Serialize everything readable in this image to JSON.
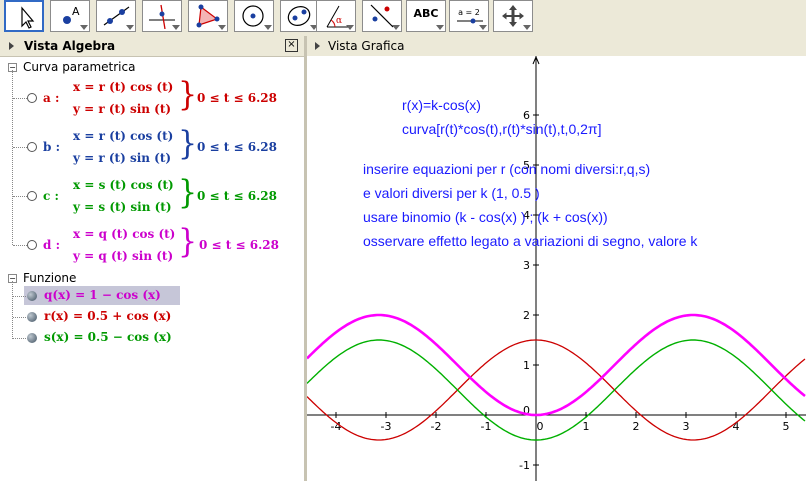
{
  "toolbar": {
    "text_tool_label": "ABC",
    "slider_tool_label": "a = 2"
  },
  "algebra": {
    "title": "Vista Algebra",
    "close_symbol": "×",
    "folder_curve": "Curva parametrica",
    "folder_function": "Funzione",
    "curves": [
      {
        "name": "a :",
        "x_eq": "x = r (t)  cos (t)",
        "y_eq": "y = r (t)  sin (t)",
        "range": "0 ≤ t ≤ 6.28",
        "color": "#cc0000"
      },
      {
        "name": "b :",
        "x_eq": "x = r (t)  cos (t)",
        "y_eq": "y = r (t)  sin (t)",
        "range": "0 ≤ t ≤ 6.28",
        "color": "#1a3fa0"
      },
      {
        "name": "c :",
        "x_eq": "x = s (t)  cos (t)",
        "y_eq": "y = s (t)  sin (t)",
        "range": "0 ≤ t ≤ 6.28",
        "color": "#009900"
      },
      {
        "name": "d :",
        "x_eq": "x = q (t)  cos (t)",
        "y_eq": "y = q (t)  sin (t)",
        "range": "0 ≤ t ≤ 6.28",
        "color": "#cc00cc"
      }
    ],
    "functions": [
      {
        "label": "q(x)  =  1 − cos (x)",
        "color": "#cc00cc",
        "selected": true
      },
      {
        "label": "r(x)  =  0.5 + cos (x)",
        "color": "#cc0000",
        "selected": false
      },
      {
        "label": "s(x)  =  0.5 − cos (x)",
        "color": "#009900",
        "selected": false
      }
    ]
  },
  "graphics": {
    "title": "Vista Grafica",
    "notes": [
      "r(x)=k-cos(x)",
      "curva[r(t)*cos(t),r(t)*sin(t),t,0,2π]",
      "inserire equazioni per r (con nomi diversi:r,q,s)",
      "e valori diversi per k (1,  0.5 )",
      "usare binomio (k - cos(x) ) ; (k + cos(x))",
      "osservare effetto legato a variazioni di segno, valore k"
    ],
    "x_ticks": [
      "-4",
      "-3",
      "-2",
      "-1",
      "0",
      "1",
      "2",
      "3",
      "4",
      "5"
    ],
    "y_ticks": [
      "-1",
      "0",
      "1",
      "2",
      "3",
      "4",
      "5",
      "6"
    ],
    "colors": {
      "q": "#ff00ff",
      "r": "#cc0000",
      "s": "#00b000",
      "note_text": "#1a1aff"
    }
  }
}
